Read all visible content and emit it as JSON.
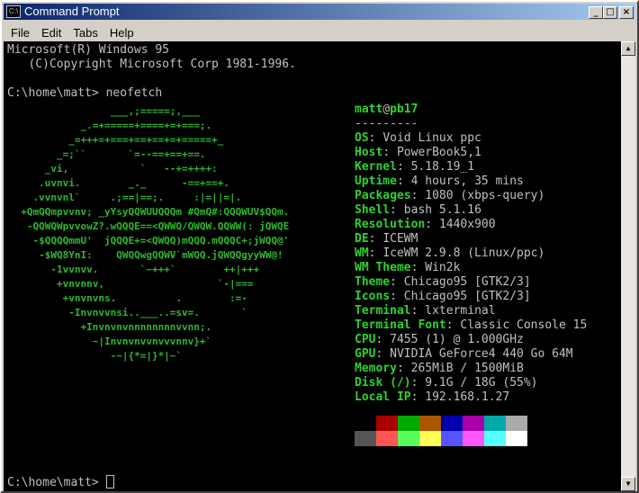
{
  "window": {
    "title": "Command Prompt",
    "icon_label": "C:\\"
  },
  "menu": [
    "File",
    "Edit",
    "Tabs",
    "Help"
  ],
  "terminal": {
    "banner_line1": "Microsoft(R) Windows 95",
    "banner_line2": "   (C)Copyright Microsoft Corp 1981-1996.",
    "prompt1": "C:\\home\\matt> neofetch",
    "prompt2": "C:\\home\\matt> ",
    "logo": "                 ___,;=====;,___\n            _.=+=====+====+=+===;.\n          _=+++=+===+==+==+=+=====+_\n        _=;``       `=--==+==+==.\n      _vi,            `   --+=++++:\n     .uvnvi.        _._      -==+==+.\n    .vvnvnl`     .;==|==;.     :|=||=|.\n  +QmQQmpvvnv; _yYsyQQWUUQQQm #QmQ#:QQQWUV$QQm.\n   -QQWQWpvvowZ?.wQQQE==<QWWQ/QWQW.QQWW(: jQWQE\n    -$QQQQmmU'  jQQQE+=<QWQQ)mQQQ.mQQQC+;jWQQ@'\n     -$WQ8YnI:    QWQQwgQQWV`mWQQ.jQWQQgyyWW@!\n       -1vvnvv.       `~+++`        ++|+++\n        +vnvnnv,                   `-|===\n         +vnvnvns.          .        :=-\n          -Invnvvnsi..___..=sv=.       `\n            +Invnvnvnnnnnnnnvvnn;.\n              ~|Invnvnvvnvvvnnv}+`\n                 -~|{*=|}*|~`",
    "info": {
      "user": "matt",
      "at": "@",
      "host": "pb17",
      "separator": "---------",
      "rows": [
        {
          "key": "OS",
          "value": "Void Linux ppc"
        },
        {
          "key": "Host",
          "value": "PowerBook5,1"
        },
        {
          "key": "Kernel",
          "value": "5.18.19_1"
        },
        {
          "key": "Uptime",
          "value": "4 hours, 35 mins"
        },
        {
          "key": "Packages",
          "value": "1080 (xbps-query)"
        },
        {
          "key": "Shell",
          "value": "bash 5.1.16"
        },
        {
          "key": "Resolution",
          "value": "1440x900"
        },
        {
          "key": "DE",
          "value": "ICEWM"
        },
        {
          "key": "WM",
          "value": "IceWM 2.9.8 (Linux/ppc)"
        },
        {
          "key": "WM Theme",
          "value": "Win2k"
        },
        {
          "key": "Theme",
          "value": "Chicago95 [GTK2/3]"
        },
        {
          "key": "Icons",
          "value": "Chicago95 [GTK2/3]"
        },
        {
          "key": "Terminal",
          "value": "lxterminal"
        },
        {
          "key": "Terminal Font",
          "value": "Classic Console 15"
        },
        {
          "key": "CPU",
          "value": "7455 (1) @ 1.000GHz"
        },
        {
          "key": "GPU",
          "value": "NVIDIA GeForce4 440 Go 64M"
        },
        {
          "key": "Memory",
          "value": "265MiB / 1500MiB"
        },
        {
          "key": "Disk (/)",
          "value": "9.1G / 18G (55%)"
        },
        {
          "key": "Local IP",
          "value": "192.168.1.27"
        }
      ]
    },
    "palette_row1": [
      "#000000",
      "#aa0000",
      "#00aa00",
      "#aa5500",
      "#0000aa",
      "#aa00aa",
      "#00aaaa",
      "#aaaaaa"
    ],
    "palette_row2": [
      "#555555",
      "#ff5555",
      "#55ff55",
      "#ffff55",
      "#5555ff",
      "#ff55ff",
      "#55ffff",
      "#ffffff"
    ]
  }
}
